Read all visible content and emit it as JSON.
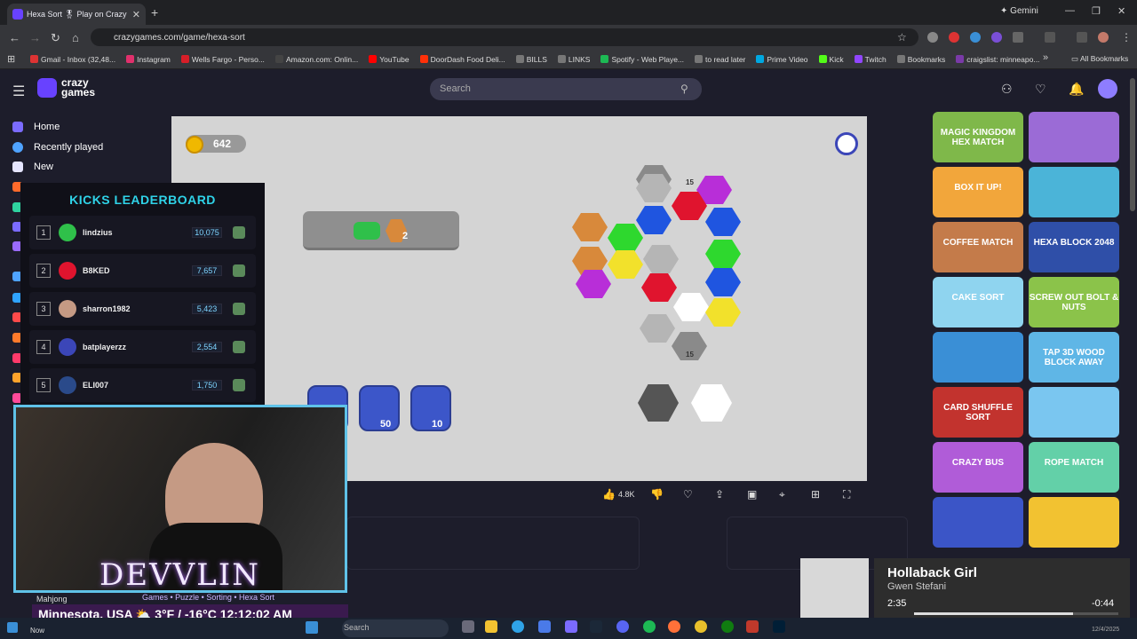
{
  "browser": {
    "tab_title": "Hexa Sort 🎖 Play on Crazy",
    "url": "crazygames.com/game/hexa-sort",
    "gemini_label": "Gemini",
    "bookmarks": [
      "Gmail - Inbox (32,48...",
      "Instagram",
      "Wells Fargo - Perso...",
      "Amazon.com: Onlin...",
      "YouTube",
      "DoorDash Food Deli...",
      "BILLS",
      "LINKS",
      "Spotify - Web Playe...",
      "to read later",
      "Prime Video",
      "Kick",
      "Twitch",
      "Bookmarks",
      "craigslist: minneapo..."
    ],
    "all_bookmarks": "All Bookmarks"
  },
  "site": {
    "logo_line1": "crazy",
    "logo_line2": "games",
    "search_placeholder": "Search"
  },
  "sidebar": {
    "items": [
      {
        "label": "Home",
        "color": "#7b6bff"
      },
      {
        "label": "Recently played",
        "color": "#4fa3ff"
      },
      {
        "label": "New",
        "color": "#e6e6ff"
      }
    ]
  },
  "game": {
    "coins": "642",
    "goal_count": "2",
    "stack_label_top": "15",
    "stack_label_bottom": "15",
    "boosters": [
      {
        "name": "hammer",
        "cost": ""
      },
      {
        "name": "hand",
        "cost": "50"
      },
      {
        "name": "shuffle",
        "cost": "10"
      }
    ]
  },
  "actions": {
    "likes": "4.8K"
  },
  "leaderboard": {
    "title": "KICKS LEADERBOARD",
    "rows": [
      {
        "rank": "1",
        "name": "lindzius",
        "score": "10,075"
      },
      {
        "rank": "2",
        "name": "B8KED",
        "score": "7,657"
      },
      {
        "rank": "3",
        "name": "sharron1982",
        "score": "5,423"
      },
      {
        "rank": "4",
        "name": "batplayerzz",
        "score": "2,554"
      },
      {
        "rank": "5",
        "name": "ELI007",
        "score": "1,750"
      }
    ]
  },
  "stream": {
    "name": "DEVVLIN",
    "tags": "Games • Puzzle • Sorting • Hexa Sort",
    "weather": "Minnesota, USA ⛅ 3°F / -16°C 12:12:02 AM",
    "mahjong": "Mahjong"
  },
  "game_tiles": [
    {
      "label": "MAGIC KINGDOM HEX MATCH",
      "color": "#7fb84a"
    },
    {
      "label": "",
      "color": "#9b6bd6"
    },
    {
      "label": "BOX IT UP!",
      "color": "#f2a63b"
    },
    {
      "label": "",
      "color": "#4bb4d8"
    },
    {
      "label": "COFFEE MATCH",
      "color": "#c47b4a"
    },
    {
      "label": "HEXA BLOCK 2048",
      "color": "#2f4fa8"
    },
    {
      "label": "CAKE SORT",
      "color": "#8fd4ef"
    },
    {
      "label": "SCREW OUT BOLT & NUTS",
      "color": "#8bc34a"
    },
    {
      "label": "",
      "color": "#3a8fd6"
    },
    {
      "label": "TAP 3D WOOD BLOCK AWAY",
      "color": "#5fb6e6"
    },
    {
      "label": "CARD SHUFFLE SORT",
      "color": "#c2332e"
    },
    {
      "label": "",
      "color": "#7ac6f0"
    },
    {
      "label": "CRAZY BUS",
      "color": "#b05cd8"
    },
    {
      "label": "ROPE MATCH",
      "color": "#63d0a8"
    },
    {
      "label": "",
      "color": "#3b55c7"
    },
    {
      "label": "",
      "color": "#f2c231"
    }
  ],
  "media": {
    "title": "Hollaback Girl",
    "artist": "Gwen Stefani",
    "elapsed": "2:35",
    "remaining": "-0:44",
    "progress": 0.78
  },
  "taskbar": {
    "search": "Search",
    "now": "Now",
    "date": "12/4/2025"
  }
}
